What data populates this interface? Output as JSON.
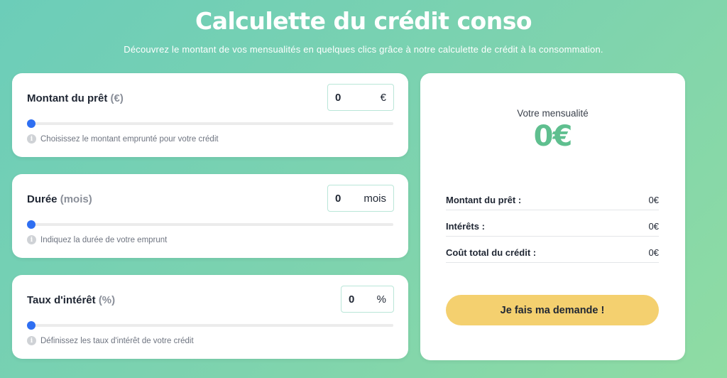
{
  "header": {
    "title": "Calculette du crédit conso",
    "subtitle": "Découvrez le montant de vos mensualités en quelques clics grâce à notre calculette de crédit à la consommation."
  },
  "inputs": [
    {
      "label": "Montant du prêt",
      "unit": "(€)",
      "value": "0",
      "suffix": "€",
      "slider_fraction": 0,
      "hint": "Choisissez le montant emprunté pour votre crédit",
      "hint_icon": "info-icon"
    },
    {
      "label": "Durée",
      "unit": "(mois)",
      "value": "0",
      "suffix": "mois",
      "slider_fraction": 0,
      "hint": "Indiquez la durée de votre emprunt",
      "hint_icon": "info-icon"
    },
    {
      "label": "Taux d'intérêt",
      "unit": "(%)",
      "value": "0",
      "suffix": "%",
      "slider_fraction": 0,
      "hint": "Définissez les taux d'intérêt de votre crédit",
      "hint_icon": "info-icon"
    }
  ],
  "result": {
    "mensualite_label": "Votre mensualité",
    "mensualite_value": "0€",
    "rows": [
      {
        "key": "Montant du prêt :",
        "value": "0€"
      },
      {
        "key": "Intérêts :",
        "value": "0€"
      },
      {
        "key": "Coût total du crédit :",
        "value": "0€"
      }
    ],
    "cta_label": "Je fais ma demande !"
  },
  "colors": {
    "accent_green": "#5fbf8f",
    "cta_yellow": "#f4d06f",
    "slider_thumb": "#2f6ff2",
    "field_border": "#b9e6d8"
  }
}
